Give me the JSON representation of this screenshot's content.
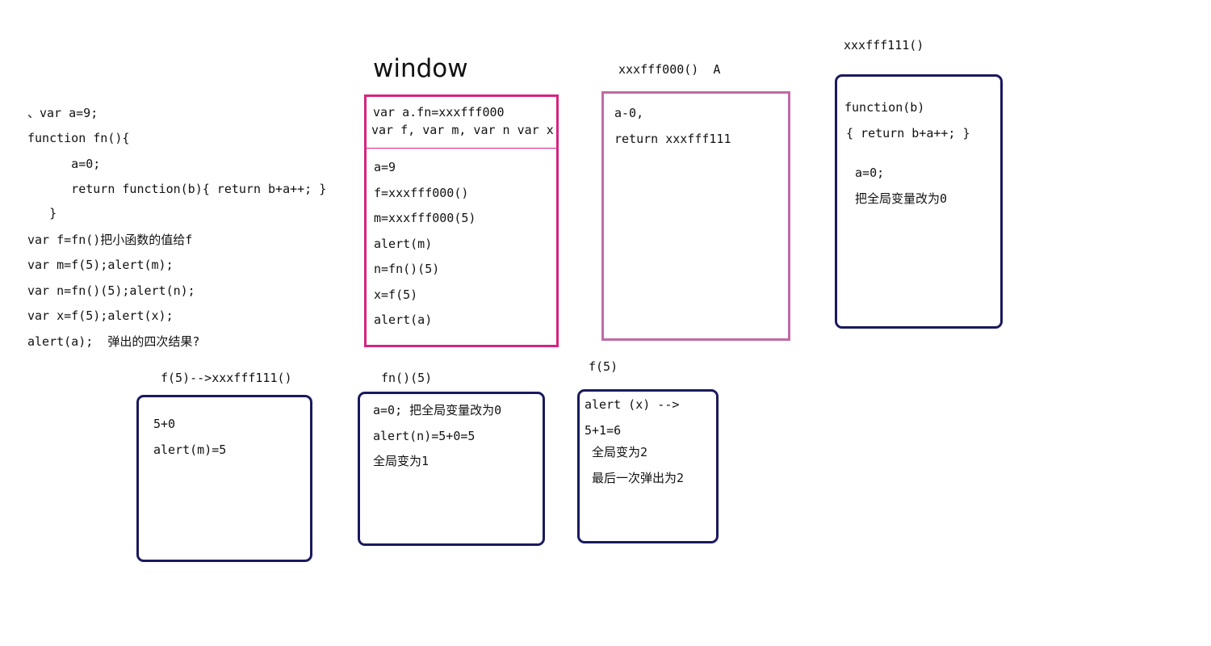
{
  "code": {
    "lines": [
      "、var a=9;",
      "function fn(){",
      "      a=0;",
      "      return function(b){ return b+a++; }",
      "   }",
      "var f=fn()把小函数的值给f",
      "var m=f(5);alert(m);",
      "var n=fn()(5);alert(n);",
      "var x=f(5);alert(x);",
      "alert(a);  弹出的四次结果?"
    ]
  },
  "window_box": {
    "title": "window",
    "header": [
      "var a.fn=xxxfff000",
      "var f, var m, var n var x"
    ],
    "lines": [
      "a=9",
      "f=xxxfff000()",
      "m=xxxfff000(5)",
      "alert(m)",
      "n=fn()(5)",
      "x=f(5)",
      "alert(a)"
    ]
  },
  "fn_box": {
    "title": "xxxfff000()  A",
    "lines": [
      "a-0,",
      "return xxxfff111"
    ]
  },
  "inner_box": {
    "title": "xxxfff111()",
    "lines": [
      "function(b)",
      "{ return b+a++; }",
      " a=0;",
      " 把全局变量改为0"
    ]
  },
  "call1": {
    "title": "f(5)-->xxxfff111()",
    "lines": [
      "5+0",
      "alert(m)=5"
    ]
  },
  "call2": {
    "title": "fn()(5)",
    "lines": [
      "a=0; 把全局变量改为0",
      "alert(n)=5+0=5",
      "全局变为1"
    ]
  },
  "call3": {
    "title": "f(5)",
    "lines": [
      "alert (x) -->",
      "5+1=6",
      " 全局变为2",
      " 最后一次弹出为2"
    ]
  },
  "colors": {
    "navy_border": "#1a1a5e",
    "magenta_border": "#d4247f",
    "mauve_border": "#c06aa5"
  }
}
